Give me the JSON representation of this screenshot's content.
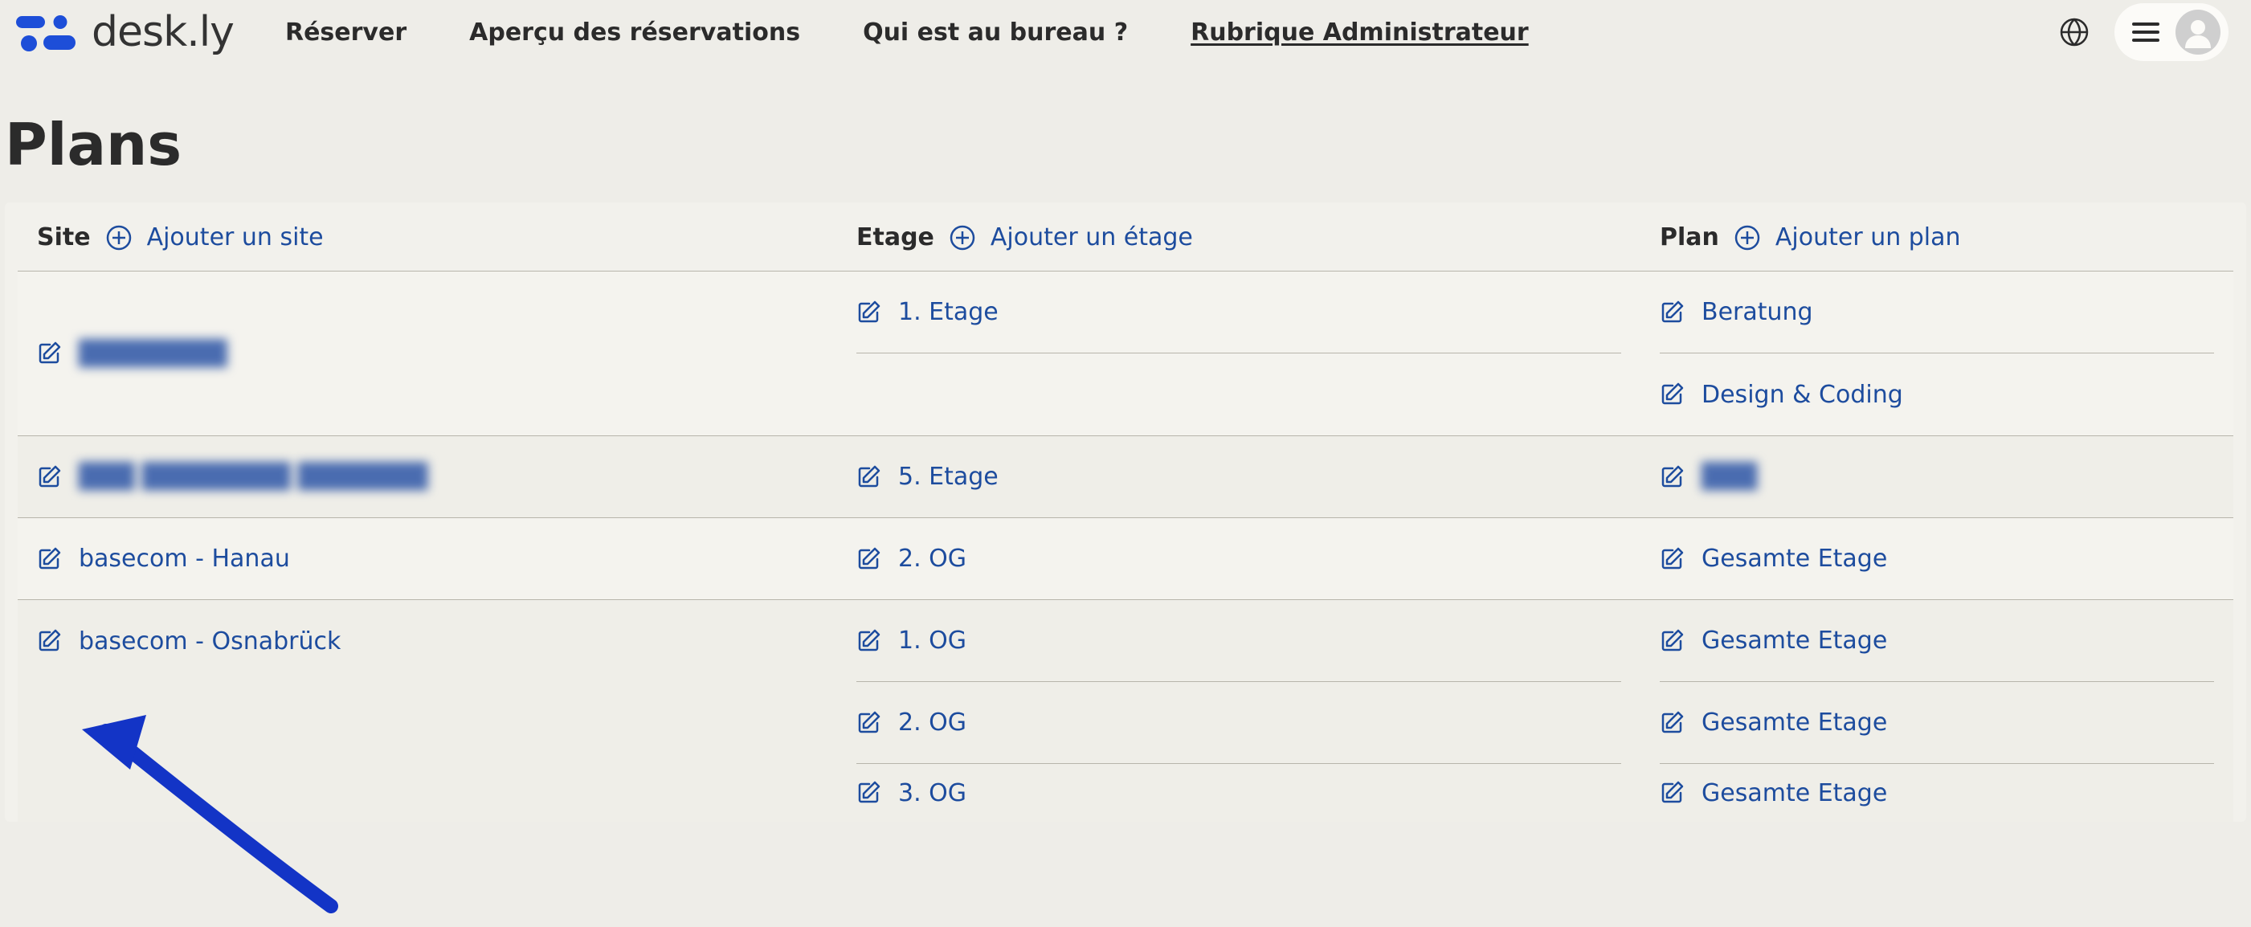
{
  "brand": {
    "word": "desk.ly"
  },
  "nav": {
    "reserver": "Réserver",
    "apercu": "Aperçu des réservations",
    "qui": "Qui est au bureau ?",
    "admin": "Rubrique Administrateur",
    "active": "admin"
  },
  "page": {
    "title": "Plans"
  },
  "columns": {
    "site": {
      "label": "Site",
      "add": "Ajouter un site"
    },
    "etage": {
      "label": "Etage",
      "add": "Ajouter un étage"
    },
    "plan": {
      "label": "Plan",
      "add": "Ajouter un plan"
    }
  },
  "rows": [
    {
      "site": {
        "text": "████████",
        "blurred": true
      },
      "etage": "1. Etage",
      "plans": [
        "Beratung",
        "Design & Coding"
      ]
    },
    {
      "site": {
        "text": "███ ████████ ███████",
        "blurred": true
      },
      "etage": "5. Etage",
      "plans_blurred": true,
      "plans": [
        "███"
      ]
    },
    {
      "site": {
        "text": "basecom - Hanau",
        "blurred": false
      },
      "etage": "2. OG",
      "plans": [
        "Gesamte Etage"
      ]
    },
    {
      "site": {
        "text": "basecom - Osnabrück",
        "blurred": false
      },
      "etages": [
        {
          "etage": "1. OG",
          "plan": "Gesamte Etage"
        },
        {
          "etage": "2. OG",
          "plan": "Gesamte Etage"
        },
        {
          "etage": "3. OG",
          "plan": "Gesamte Etage"
        }
      ]
    }
  ]
}
